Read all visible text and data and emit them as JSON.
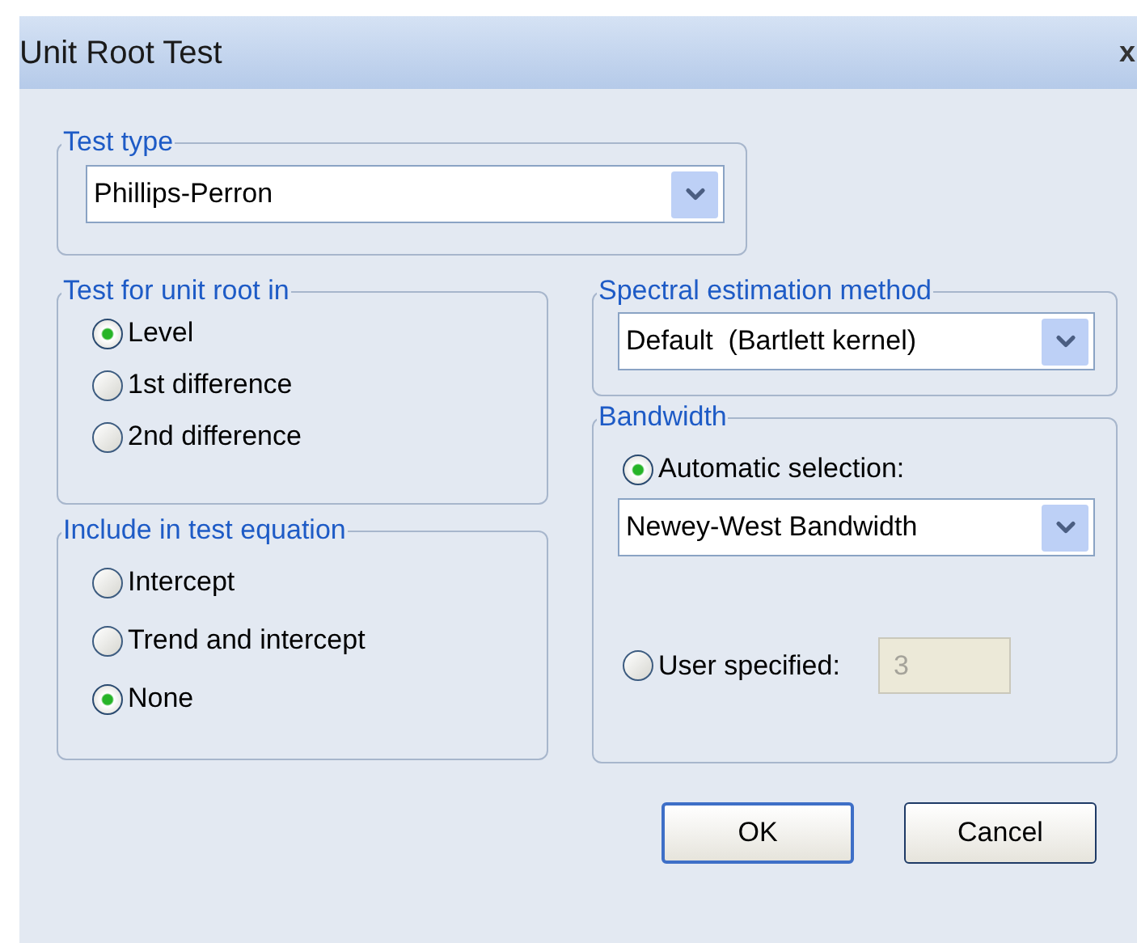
{
  "window": {
    "title": "Unit Root Test",
    "close": "x"
  },
  "test_type": {
    "label": "Test type",
    "value": "Phillips-Perron"
  },
  "unit_root": {
    "label": "Test for unit root in",
    "options": [
      {
        "label": "Level",
        "selected": true
      },
      {
        "label": "1st difference",
        "selected": false
      },
      {
        "label": "2nd difference",
        "selected": false
      }
    ]
  },
  "include": {
    "label": "Include in test equation",
    "options": [
      {
        "label": "Intercept",
        "selected": false
      },
      {
        "label": "Trend and intercept",
        "selected": false
      },
      {
        "label": "None",
        "selected": true
      }
    ]
  },
  "spectral": {
    "label": "Spectral estimation method",
    "value": "Default  (Bartlett kernel)"
  },
  "bandwidth": {
    "label": "Bandwidth",
    "options": [
      {
        "kind": "select",
        "label": "Automatic selection:",
        "selected": true,
        "value": "Newey-West Bandwidth"
      },
      {
        "kind": "input",
        "label": "User specified:",
        "selected": false,
        "value": "3",
        "disabled": true
      }
    ]
  },
  "buttons": [
    {
      "label": "OK",
      "default": true
    },
    {
      "label": "Cancel",
      "default": false
    }
  ]
}
